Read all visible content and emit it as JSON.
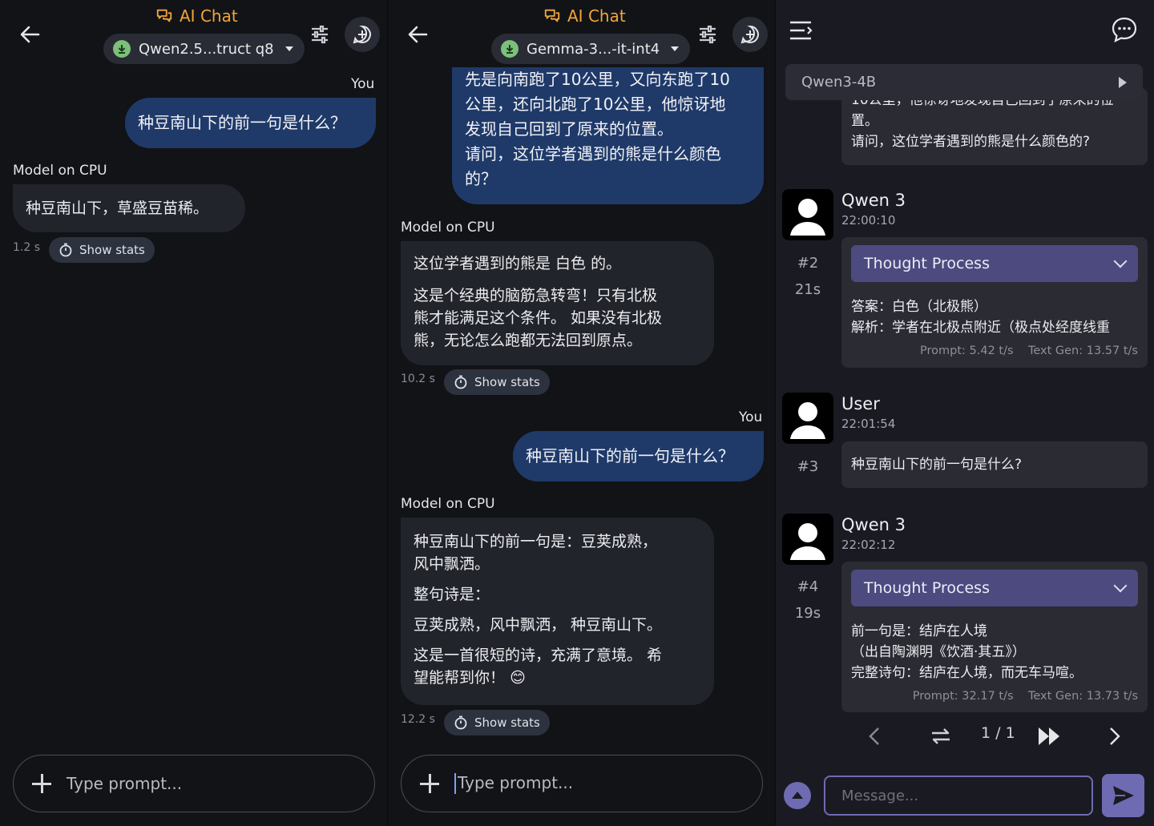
{
  "screen1": {
    "title": "AI Chat",
    "model": "Qwen2.5...truct q8",
    "you_label": "You",
    "user_message": "种豆南山下的前一句是什么？",
    "model_label": "Model on CPU",
    "assistant_message": "种豆南山下，草盛豆苗稀。",
    "time": "1.2 s",
    "stats_label": "Show stats",
    "prompt_placeholder": "Type prompt..."
  },
  "screen2": {
    "title": "AI Chat",
    "model": "Gemma-3...-it-int4",
    "user_message_1": [
      "先是向南跑了10公里，又向东跑了10",
      "公里，还向北跑了10公里，他惊讶地",
      "发现自己回到了原来的位置。",
      "请问，这位学者遇到的熊是什么颜色",
      "的？"
    ],
    "model_label_1": "Model on CPU",
    "assistant_message_1": [
      "这位学者遇到的熊是 白色 的。",
      "这是个经典的脑筋急转弯！只有北极",
      "熊才能满足这个条件。 如果没有北极",
      "熊，无论怎么跑都无法回到原点。"
    ],
    "time_1": "10.2 s",
    "stats_label_1": "Show stats",
    "you_label": "You",
    "user_message_2": "种豆南山下的前一句是什么？",
    "model_label_2": "Model on CPU",
    "assistant_message_2": [
      "种豆南山下的前一句是：豆荚成熟，",
      "风中飘洒。",
      "整句诗是：",
      "豆荚成熟，风中飘洒， 种豆南山下。",
      "这是一首很短的诗，充满了意境。 希",
      "望能帮到你！"
    ],
    "emoji": "😊",
    "time_2": "12.2 s",
    "stats_label_2": "Show stats",
    "prompt_placeholder": "Type prompt..."
  },
  "screen3": {
    "model": "Qwen3-4B",
    "top_card_text": [
      "置。",
      "请问，这位学者遇到的熊是什么颜色的?"
    ],
    "top_card_clipped": "10公里，他惊讶地发现自己回到了原来的位",
    "messages": [
      {
        "who": "Qwen 3",
        "time": "22:00:10",
        "index": "#2",
        "duration": "21s",
        "thought_label": "Thought Process",
        "text": "答案：白色（北极熊）\n解析：学者在北极点附近（极点处经度线重",
        "speed": "Prompt: 5.42 t/s    Text Gen: 13.57 t/s"
      },
      {
        "who": "User",
        "time": "22:01:54",
        "index": "#3",
        "text": "种豆南山下的前一句是什么?"
      },
      {
        "who": "Qwen 3",
        "time": "22:02:12",
        "index": "#4",
        "duration": "19s",
        "thought_label": "Thought Process",
        "text": "前一句是：结庐在人境\n（出自陶渊明《饮酒·其五》）\n完整诗句：结庐在人境，而无车马喧。",
        "speed": "Prompt: 32.17 t/s    Text Gen: 13.73 t/s"
      }
    ],
    "pager": "1 / 1",
    "message_placeholder": "Message..."
  },
  "colors": {
    "accent": "#f2a53a",
    "user_bubble": "#1f3a69",
    "purple": "#6e6bb2",
    "thought": "#4d4a80"
  }
}
